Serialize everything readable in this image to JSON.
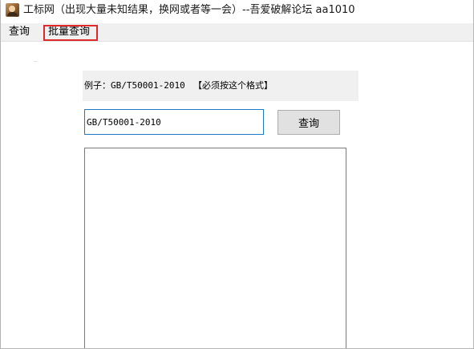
{
  "window": {
    "title": "工标网（出现大量未知结果，换网或者等一会）--吾爱破解论坛 aa1010",
    "icon": "app-avatar-icon"
  },
  "menubar": {
    "items": [
      {
        "label": "查询"
      },
      {
        "label": "批量查询"
      }
    ],
    "highlight_color": "#e0292b"
  },
  "main": {
    "example_label": "例子：GB/T50001-2010",
    "example_hint": "【必须按这个格式】",
    "search_input": {
      "value": "GB/T50001-2010"
    },
    "query_button_label": "查询",
    "result_text": ""
  }
}
